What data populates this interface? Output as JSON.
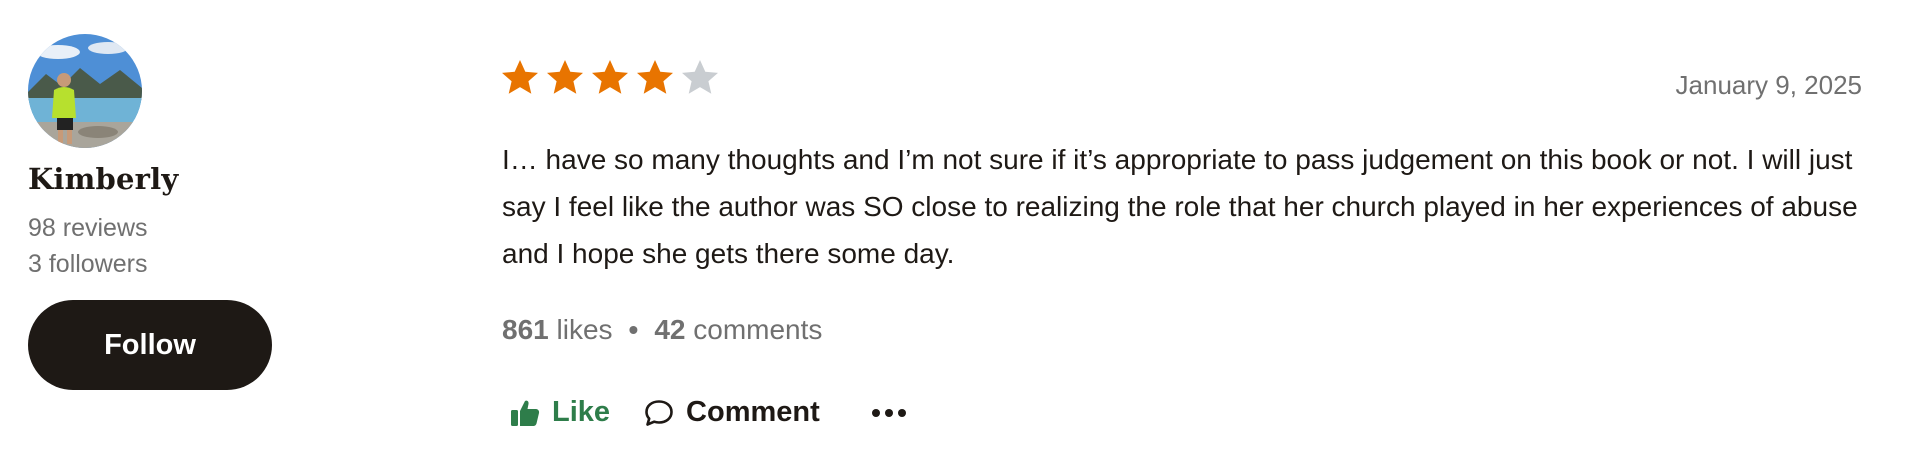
{
  "reviewer": {
    "name": "Kimberly",
    "reviews": "98 reviews",
    "followers": "3 followers",
    "follow_label": "Follow"
  },
  "review": {
    "rating": 4,
    "max_rating": 5,
    "date": "January 9, 2025",
    "text": "I… have so many thoughts and I’m not sure if it’s appropriate to pass judgement on this book or not. I will just say I feel like the author was SO close to realizing the role that her church played in her experiences of abuse and I hope she gets there some day.",
    "likes_count": "861",
    "likes_word": "likes",
    "separator": "•",
    "comments_count": "42",
    "comments_word": "comments"
  },
  "actions": {
    "like_label": "Like",
    "comment_label": "Comment"
  },
  "colors": {
    "star_filled": "#e87400",
    "star_empty": "#c9cdd1",
    "like_green": "#2e7d4a",
    "button_dark": "#1e1915"
  },
  "icons": [
    "thumbs-up-icon",
    "comment-bubble-icon",
    "more-options-icon",
    "star-icon"
  ]
}
